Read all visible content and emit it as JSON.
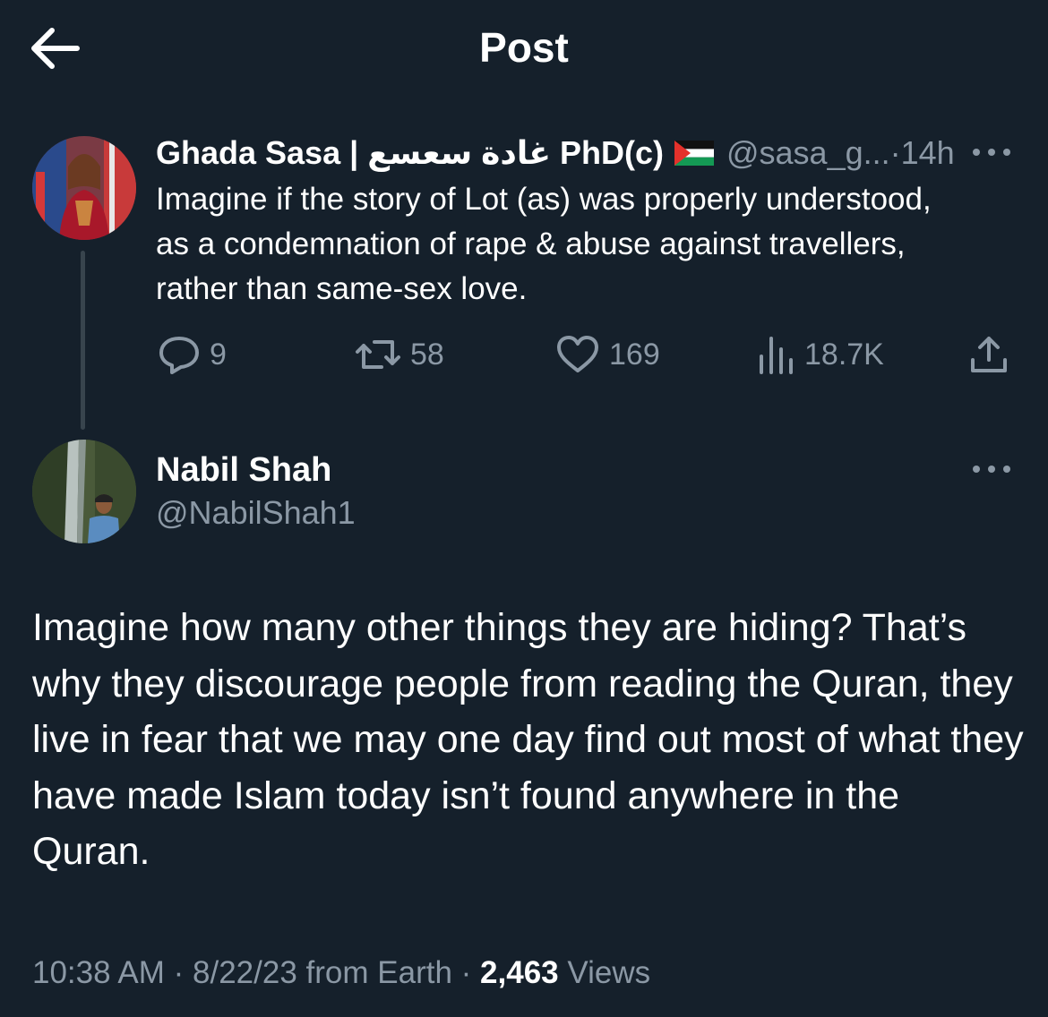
{
  "header": {
    "title": "Post"
  },
  "quoted_post": {
    "author_name": "Ghada Sasa | غادة سعسع PhD(c)",
    "handle": "@sasa_g...",
    "separator": "·",
    "time": "14h",
    "text": "Imagine if the story of Lot (as) was properly understood, as a condemnation of rape & abuse against travellers, rather than same-sex love.",
    "stats": {
      "replies": "9",
      "reposts": "58",
      "likes": "169",
      "views": "18.7K"
    }
  },
  "post": {
    "author_name": "Nabil Shah",
    "handle": "@NabilShah1",
    "text": "Imagine how many other things they are hiding? That’s why they discourage people from reading the Quran, they live in fear that we may one day find out most of what they have made Islam today isn’t found anywhere in the Quran.",
    "time": "10:38 AM",
    "date": "8/22/23",
    "source": "from Earth",
    "views_count": "2,463",
    "views_label": "Views",
    "sep": "·"
  },
  "colors": {
    "background": "#15202b",
    "text": "#ffffff",
    "secondary": "#8b98a5",
    "line": "#38444d"
  },
  "icons": [
    "back-arrow-icon",
    "more-icon",
    "reply-icon",
    "repost-icon",
    "like-icon",
    "views-icon",
    "share-icon",
    "palestine-flag-icon"
  ]
}
